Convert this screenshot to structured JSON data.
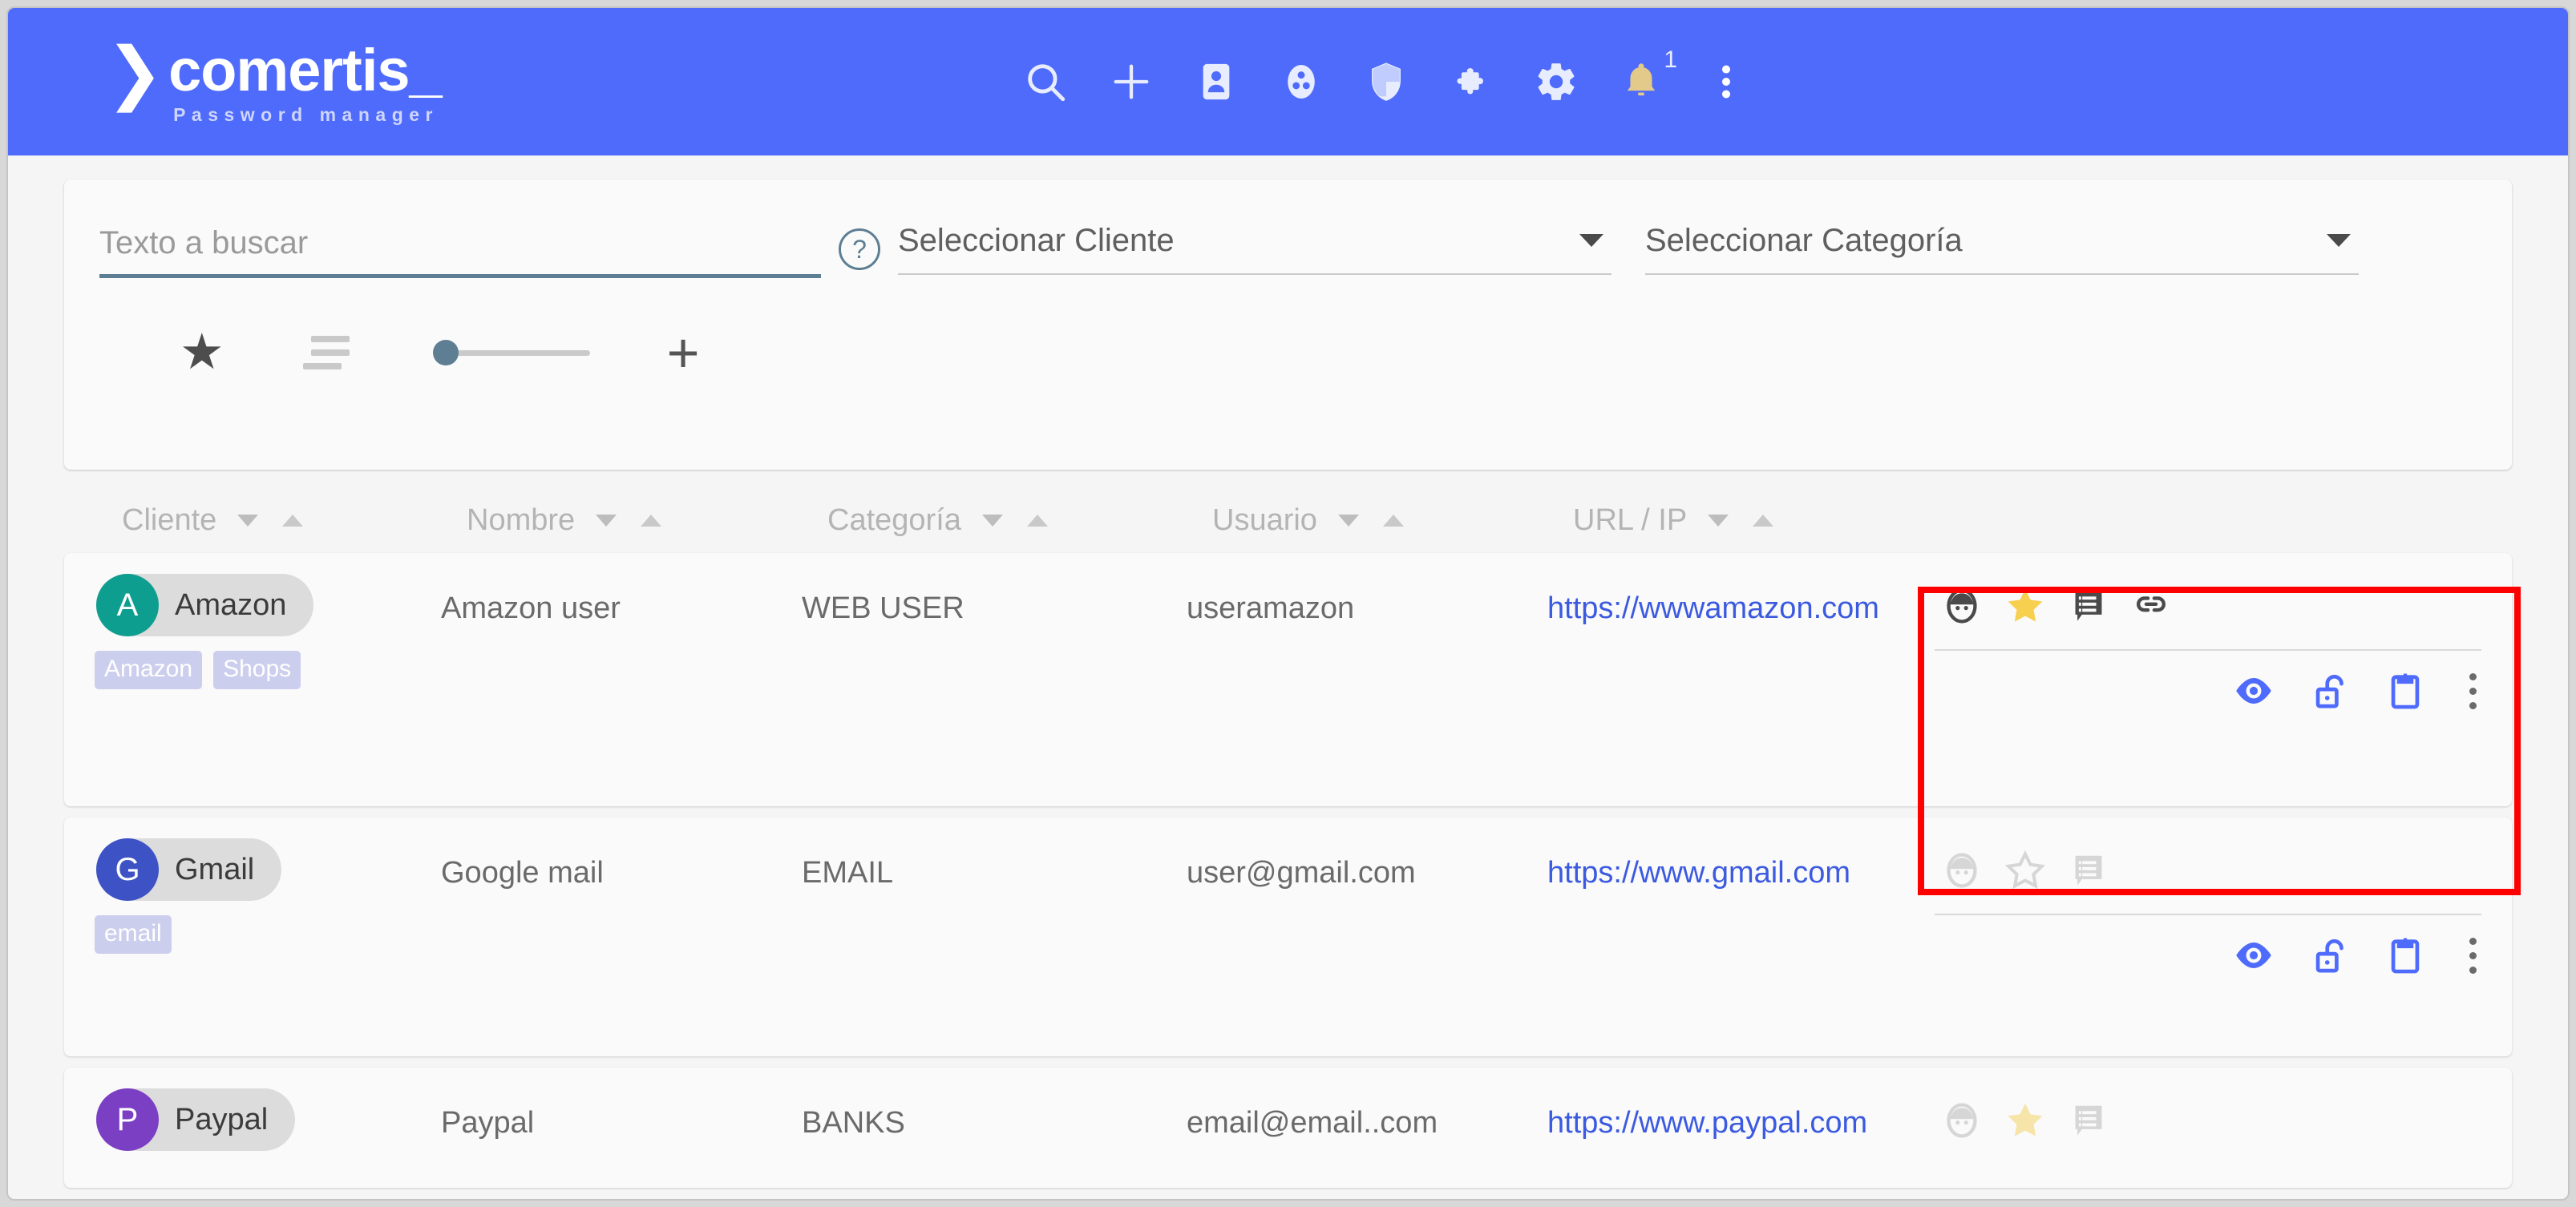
{
  "header": {
    "brand_chevron": "❯",
    "brand_name": "comertis_",
    "brand_subtitle": "Password manager",
    "accent_color": "#4f6bfb",
    "icons": [
      {
        "name": "search-icon",
        "label": "Buscar"
      },
      {
        "name": "add-icon",
        "label": "Añadir"
      },
      {
        "name": "contact-card-icon",
        "label": "Clientes"
      },
      {
        "name": "groups-icon",
        "label": "Grupos"
      },
      {
        "name": "shield-icon",
        "label": "Seguridad"
      },
      {
        "name": "puzzle-icon",
        "label": "Extensiones"
      },
      {
        "name": "gear-icon",
        "label": "Configuración"
      }
    ],
    "notification": {
      "name": "bell-icon",
      "badge": "1",
      "color": "#e3c98a"
    },
    "overflow": {
      "name": "kebab-menu-icon"
    }
  },
  "search_panel": {
    "search_input": {
      "value": "",
      "placeholder": "Texto a buscar"
    },
    "help_icon_label": "?",
    "client_select": {
      "value": "Seleccionar Cliente"
    },
    "category_select": {
      "value": "Seleccionar Categoría"
    },
    "tools": [
      {
        "name": "favorite-filter-star-icon",
        "glyph": "★"
      },
      {
        "name": "sort-lines-icon"
      },
      {
        "name": "density-slider"
      },
      {
        "name": "add-entry-plus-icon",
        "glyph": "+"
      }
    ]
  },
  "table": {
    "columns": [
      {
        "label": "Cliente",
        "sortable": true
      },
      {
        "label": "Nombre",
        "sortable": true
      },
      {
        "label": "Categoría",
        "sortable": true
      },
      {
        "label": "Usuario",
        "sortable": true
      },
      {
        "label": "URL / IP",
        "sortable": true
      }
    ],
    "rows": [
      {
        "client": "Amazon",
        "avatar_letter": "A",
        "avatar_color": "#0e9e8f",
        "name": "Amazon user",
        "category": "WEB USER",
        "user": "useramazon",
        "url": "https://wwwamazon.com",
        "tags": [
          "Amazon",
          "Shops"
        ],
        "favorite": true,
        "has_link": true,
        "active": true,
        "icons_top": [
          "person-face-icon",
          "star-icon",
          "note-comment-icon",
          "link-icon"
        ],
        "icons_bottom": [
          "eye-icon",
          "unlock-icon",
          "clipboard-icon",
          "kebab-menu-icon"
        ]
      },
      {
        "client": "Gmail",
        "avatar_letter": "G",
        "avatar_color": "#3d52c4",
        "name": "Google mail",
        "category": "EMAIL",
        "user": "user@gmail.com",
        "url": "https://www.gmail.com",
        "tags": [
          "email"
        ],
        "favorite": false,
        "has_link": false,
        "active": false,
        "icons_top": [
          "person-face-icon",
          "star-icon",
          "note-comment-icon"
        ],
        "icons_bottom": [
          "eye-icon",
          "unlock-icon",
          "clipboard-icon",
          "kebab-menu-icon"
        ]
      },
      {
        "client": "Paypal",
        "avatar_letter": "P",
        "avatar_color": "#7b3fc4",
        "name": "Paypal",
        "category": "BANKS",
        "user": "email@email..com",
        "url": "https://www.paypal.com",
        "tags": [],
        "favorite": false,
        "has_link": false,
        "active": false,
        "icons_top": [
          "person-face-icon",
          "star-icon",
          "note-comment-icon"
        ],
        "icons_bottom": []
      }
    ]
  },
  "annotation": {
    "color": "#ff0000",
    "target": "row-actions-panel"
  }
}
